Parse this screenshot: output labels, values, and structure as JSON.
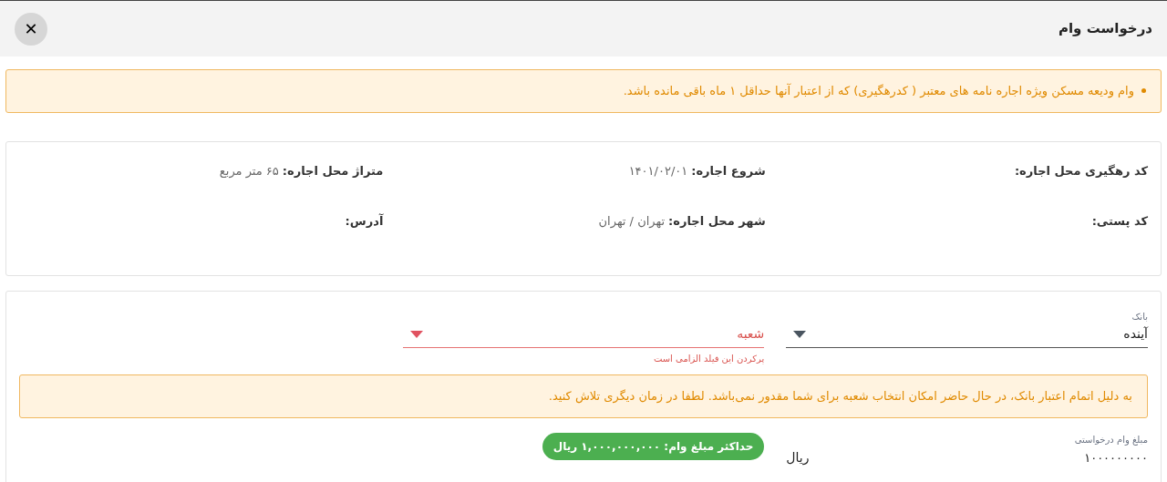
{
  "dialog": {
    "title": "درخواست وام",
    "close_button": "✕"
  },
  "notice": {
    "items": [
      "وام ودیعه مسکن ویژه اجاره نامه های معتبر ( کدرهگیری) که از اعتبار آنها حداقل ۱ ماه باقی مانده باشد."
    ]
  },
  "lease_info": [
    {
      "label": "کد رهگیری محل اجاره:"
    },
    {
      "label": "شروع اجاره:",
      "value": "۱۴۰۱/۰۲/۰۱"
    },
    {
      "label": "متراژ محل اجاره:",
      "value": "۶۵ متر مربع"
    },
    {
      "label": "کد پستی:"
    },
    {
      "label": "شهر محل اجاره:",
      "value": "تهران / تهران"
    },
    {
      "label": "آدرس:"
    }
  ],
  "form": {
    "bank": {
      "label": "بانک",
      "value": "آینده",
      "error": false
    },
    "branch": {
      "placeholder": "شعبه",
      "error": true,
      "error_text": "پرکردن این فیلد الزامی است"
    },
    "warning": "به دلیل اتمام اعتبار بانک، در حال حاضر امکان انتخاب شعبه برای شما مقدور نمی‌باشد. لطفا در زمان دیگری تلاش کنید.",
    "amount": {
      "label": "مبلغ وام درخواستی",
      "value": "۱۰۰۰۰۰۰۰۰۰",
      "unit": "ریال"
    },
    "max_badge": "حداکثر مبلغ وام: ۱,۰۰۰,۰۰۰,۰۰۰ ریال"
  }
}
